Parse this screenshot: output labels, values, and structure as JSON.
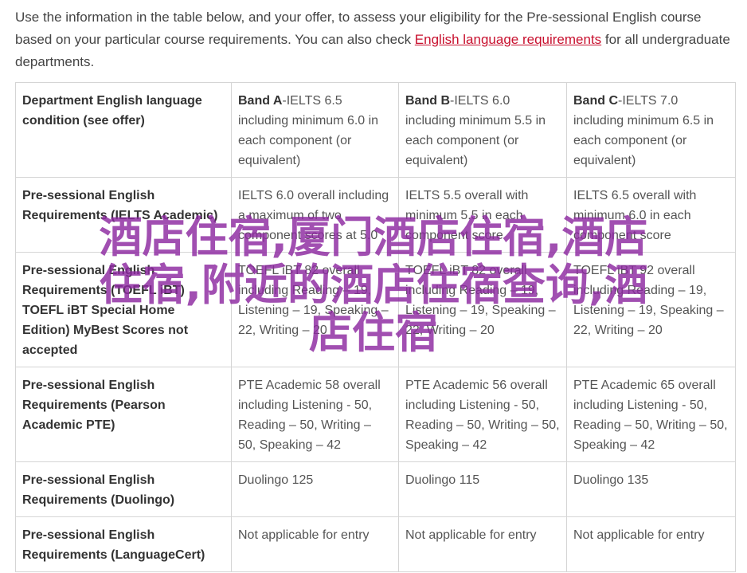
{
  "intro": {
    "text_before": "Use the information in the table below, and your offer, to assess your eligibility for the Pre-sessional English course based on your particular course requirements. You can also check ",
    "link_text": "English language requirements",
    "text_after": " for all undergraduate departments."
  },
  "table": {
    "header": {
      "label": "Department English language condition (see offer)",
      "bands": [
        {
          "name": "Band A",
          "detail": "-IELTS 6.5 including minimum 6.0 in each component (or equivalent)"
        },
        {
          "name": "Band B",
          "detail": "-IELTS 6.0 including minimum 5.5 in each component (or equivalent)"
        },
        {
          "name": "Band C",
          "detail": "-IELTS 7.0 including minimum 6.5 in each component (or equivalent)"
        }
      ]
    },
    "rows": [
      {
        "label": "Pre-sessional English Requirements (IELTS Academic)",
        "values": [
          "IELTS 6.0 overall including a maximum of two component scores at 5.0",
          "IELTS 5.5 overall with minimum 5.5 in each component score",
          "IELTS 6.5 overall with minimum 6.0 in each component score"
        ]
      },
      {
        "label": "Pre-sessional English Requirements (TOEFL iBT) TOEFL iBT Special Home Edition) MyBest Scores not accepted",
        "values": [
          "TOEFL iBT 82 overall including Reading – 19, Listening – 19, Speaking – 22, Writing – 20",
          "TOEFL iBT 82 overall including Reading – 19, Listening – 19, Speaking – 22, Writing – 20",
          "TOEFL iBT 92 overall including Reading – 19, Listening – 19, Speaking – 22, Writing – 20"
        ]
      },
      {
        "label": "Pre-sessional English Requirements (Pearson Academic PTE)",
        "values": [
          "PTE Academic 58 overall including Listening - 50, Reading – 50, Writing – 50, Speaking – 42",
          "PTE Academic 56 overall including Listening - 50, Reading – 50, Writing – 50, Speaking – 42",
          "PTE Academic 65 overall including Listening - 50, Reading – 50, Writing – 50, Speaking – 42"
        ]
      },
      {
        "label": "Pre-sessional English Requirements (Duolingo)",
        "values": [
          "Duolingo 125",
          "Duolingo 115",
          "Duolingo 135"
        ]
      },
      {
        "label": "Pre-sessional English Requirements (LanguageCert)",
        "values": [
          "Not applicable for entry",
          "Not applicable for entry",
          "Not applicable for entry"
        ]
      }
    ]
  },
  "watermark": {
    "line1": "酒店住宿,厦门酒店住宿,酒店",
    "line2": "住宿,附近的酒店住宿查询,酒",
    "line3": "店住宿"
  }
}
